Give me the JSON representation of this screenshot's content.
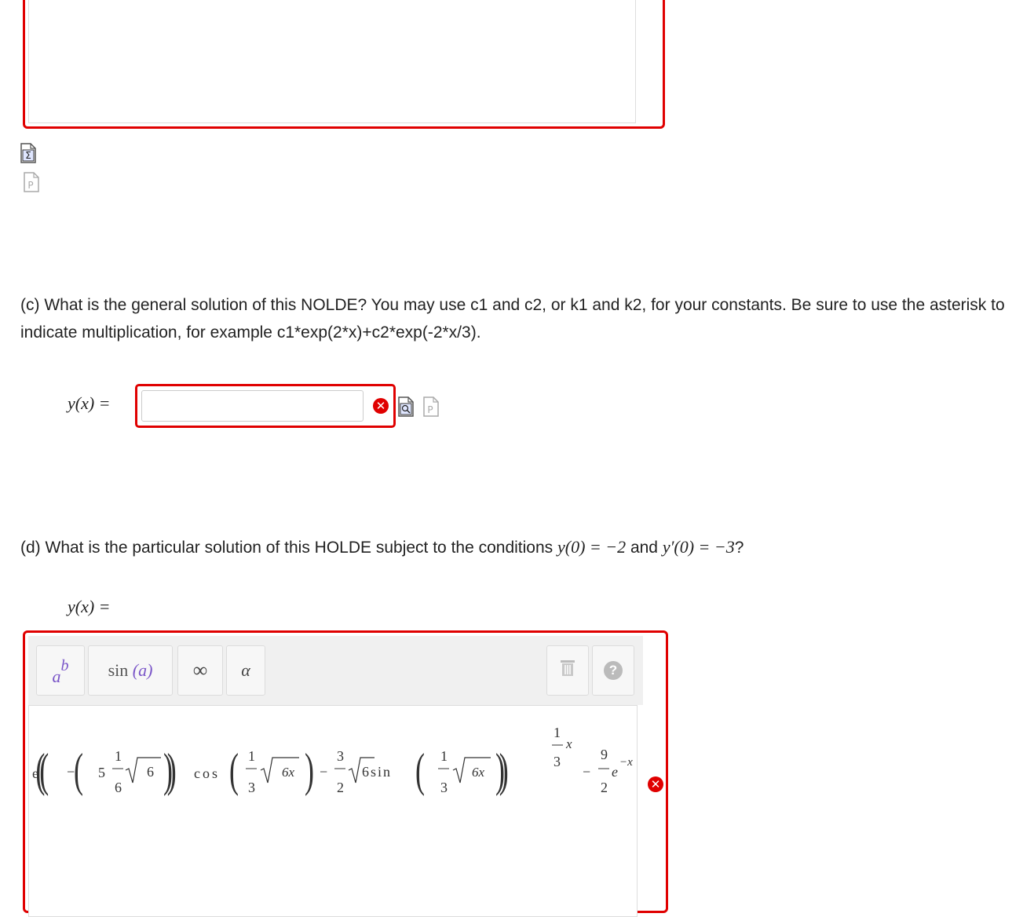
{
  "part_c": {
    "question": "(c) What is the general solution of this NOLDE? You may use c1 and c2, or k1 and k2, for your constants. Be sure to use the asterisk to indicate multiplication, for example c1*exp(2*x)+c2*exp(-2*x/3).",
    "answer_label": "y(x) =",
    "answer_value": "",
    "error_glyph": "✕"
  },
  "part_d": {
    "question_prefix": "(d) What is the particular solution of this HOLDE subject to the conditions ",
    "condition1": "y(0) = −2",
    "and": " and ",
    "condition2": "y′(0) = −3",
    "question_suffix": "?",
    "answer_label": "y(x) =",
    "toolbar": {
      "power_base": "a",
      "power_exp": "b",
      "sin_label": "sin",
      "sin_arg": "(a)",
      "infinity": "∞",
      "alpha": "α",
      "help": "?"
    },
    "expression": {
      "e": "e",
      "five": "5",
      "one": "1",
      "six": "6",
      "sqrt6": "6",
      "cos": "cos",
      "three": "3",
      "sqrt6x": "6x",
      "minus": "−",
      "three_top": "3",
      "two": "2",
      "six_sin": "6sin",
      "x": "x",
      "nine": "9",
      "neg_x": "−x"
    },
    "error_glyph": "✕"
  }
}
